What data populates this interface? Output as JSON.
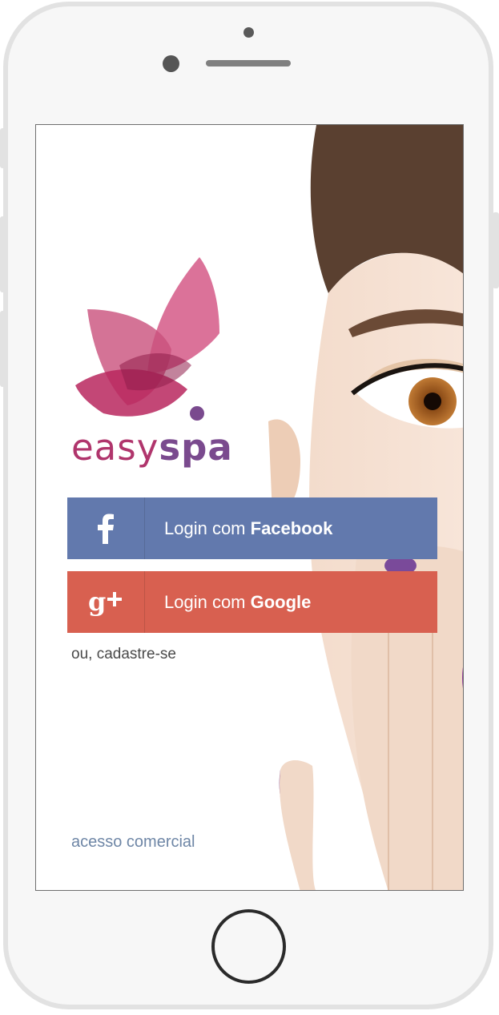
{
  "brand": {
    "easy": "easy",
    "spa": "spa"
  },
  "buttons": {
    "facebook": {
      "prefix": "Login com ",
      "provider": "Facebook",
      "icon": "facebook-f-icon",
      "color": "#6279ad"
    },
    "google": {
      "prefix": "Login com ",
      "provider": "Google",
      "icon": "google-plus-icon",
      "color": "#d86050"
    }
  },
  "links": {
    "signup": "ou, cadastre-se",
    "commercial": "acesso comercial"
  },
  "colors": {
    "logo_pink": "#c7446f",
    "logo_purple": "#7a4a8e"
  }
}
